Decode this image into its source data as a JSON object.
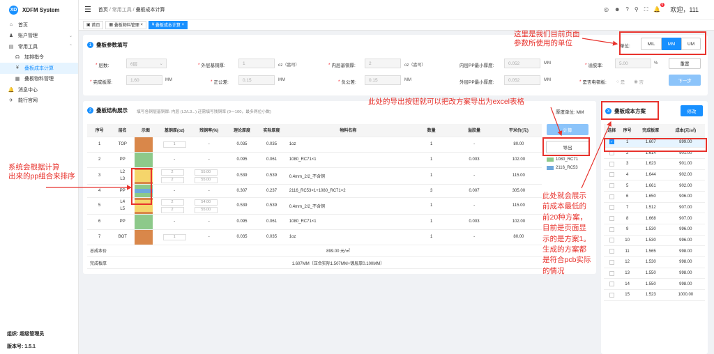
{
  "app": {
    "name": "XDFM System",
    "logo": "XD"
  },
  "sidebar": {
    "items": [
      {
        "label": "首页",
        "icon": "home-icon",
        "glyph": "⌂"
      },
      {
        "label": "账户管理",
        "icon": "user-icon",
        "glyph": "♟",
        "arrow": "⌄"
      },
      {
        "label": "常用工具",
        "icon": "tool-icon",
        "glyph": "▤",
        "arrow": "⌃"
      },
      {
        "label": "加排指令",
        "icon": "cmd-icon",
        "glyph": "☊"
      },
      {
        "label": "叠板成本计算",
        "icon": "yen-icon",
        "glyph": "¥"
      },
      {
        "label": "叠板物料管理",
        "icon": "grid-icon",
        "glyph": "▦"
      },
      {
        "label": "消息中心",
        "icon": "bell-icon",
        "glyph": "🔔"
      },
      {
        "label": "能行官网",
        "icon": "send-icon",
        "glyph": "✈"
      }
    ],
    "org": "组织: 超级管理员",
    "version": "版本号: 1.5.1"
  },
  "header": {
    "breadcrumb": [
      "首页",
      "常用工具",
      "叠板成本计算"
    ],
    "welcome": "欢迎，111",
    "notify_count": "6"
  },
  "tabs": [
    "首页",
    "叠板物料管理",
    "叠板成本计算"
  ],
  "section1": {
    "title": "叠板参数填写",
    "unit_label": "单位:",
    "units": [
      "MIL",
      "MM",
      "UM"
    ],
    "selected_unit": "MM",
    "fields": {
      "layers": {
        "label": "层数:",
        "value": "6层"
      },
      "outer_cu": {
        "label": "外层基铜厚:",
        "value": "1",
        "unit": "oz（盎司）"
      },
      "inner_cu": {
        "label": "内层基铜厚:",
        "value": "2",
        "unit": "oz（盎司）"
      },
      "pp_min": {
        "label": "内层PP最小厚度:",
        "value": "0.052",
        "unit": "MM"
      },
      "overflow": {
        "label": "溢胶率:",
        "value": "5.00",
        "unit": "%"
      },
      "finish": {
        "label": "完成板厚:",
        "value": "1.60",
        "unit": "MM"
      },
      "pos_tol": {
        "label": "正公差:",
        "value": "0.15",
        "unit": "MM"
      },
      "neg_tol": {
        "label": "负公差:",
        "value": "0.15",
        "unit": "MM"
      },
      "pp_max": {
        "label": "外层PP最小厚度:",
        "value": "0.052",
        "unit": "MM"
      },
      "cu_plate": {
        "label": "是否电铜板:",
        "opt1": "是",
        "opt2": "否"
      }
    },
    "reset": "重置",
    "next": "下一步"
  },
  "section2": {
    "title": "叠板结构展示",
    "hint": "填写各铜层基铜厚: 内层 (L2/L3...) 还需填写残铜率 (0～100，最多两位小数)",
    "thick_unit": "厚度单位: MM",
    "calc": "计算",
    "export": "导出",
    "columns": [
      "序号",
      "层名",
      "示图",
      "基铜厚(oz)",
      "残铜率(%)",
      "理论厚度",
      "实际厚度",
      "物料名称",
      "数量",
      "溢胶量",
      "平米价(元)"
    ],
    "rows": [
      {
        "no": "1",
        "name": "TOP",
        "cu": "1",
        "res": "-",
        "theo": "0.035",
        "act": "0.035",
        "mat": "1oz",
        "qty": "1",
        "ov": "-",
        "price": "80.00"
      },
      {
        "no": "2",
        "name": "PP",
        "cu": "-",
        "res": "-",
        "theo": "0.095",
        "act": "0.061",
        "mat": "1080_RC71×1",
        "qty": "1",
        "ov": "0.003",
        "price": "102.00"
      },
      {
        "no": "3",
        "name": "L2\nL3",
        "cu2": [
          "2",
          "2"
        ],
        "res2": [
          "55.00",
          "55.00"
        ],
        "theo": "0.539",
        "act": "0.539",
        "mat": "0.4mm_2/2_不含铜",
        "qty": "1",
        "ov": "-",
        "price": "115.00"
      },
      {
        "no": "4",
        "name": "PP",
        "cu": "-",
        "res": "-",
        "theo": "0.307",
        "act": "0.237",
        "mat": "2116_RC53×1+1080_RC71×2",
        "qty": "3",
        "ov": "0.007",
        "price": "305.00"
      },
      {
        "no": "5",
        "name": "L4\nL5",
        "cu2": [
          "2",
          "2"
        ],
        "res2": [
          "54.00",
          "55.00"
        ],
        "theo": "0.539",
        "act": "0.539",
        "mat": "0.4mm_2/2_不含铜",
        "qty": "1",
        "ov": "-",
        "price": "115.00"
      },
      {
        "no": "6",
        "name": "PP",
        "cu": "-",
        "res": "-",
        "theo": "0.095",
        "act": "0.061",
        "mat": "1080_RC71×1",
        "qty": "1",
        "ov": "0.003",
        "price": "102.00"
      },
      {
        "no": "7",
        "name": "BOT",
        "cu": "1",
        "res": "-",
        "theo": "0.035",
        "act": "0.035",
        "mat": "1oz",
        "qty": "1",
        "ov": "-",
        "price": "80.00"
      }
    ],
    "total_cost_label": "总成本价",
    "total_cost": "899.00 元/㎡",
    "finish_label": "完成板厚",
    "finish_value": "1.607MM（压合实际1.507MM+镀层厚0.100MM）",
    "legend": [
      "1080_RC71",
      "2116_RC53"
    ]
  },
  "section3": {
    "title": "叠板成本方案",
    "edit": "修改",
    "columns": [
      "选择",
      "序号",
      "完成板厚",
      "成本(元/㎡)"
    ],
    "rows": [
      [
        "1",
        "1.607",
        "899.00"
      ],
      [
        "2",
        "1.614",
        "901.00"
      ],
      [
        "3",
        "1.623",
        "901.00"
      ],
      [
        "4",
        "1.644",
        "902.00"
      ],
      [
        "5",
        "1.661",
        "902.00"
      ],
      [
        "6",
        "1.650",
        "906.00"
      ],
      [
        "7",
        "1.512",
        "907.00"
      ],
      [
        "8",
        "1.668",
        "907.00"
      ],
      [
        "9",
        "1.530",
        "996.00"
      ],
      [
        "10",
        "1.530",
        "996.00"
      ],
      [
        "11",
        "1.565",
        "998.00"
      ],
      [
        "12",
        "1.530",
        "998.00"
      ],
      [
        "13",
        "1.550",
        "998.00"
      ],
      [
        "14",
        "1.550",
        "998.00"
      ],
      [
        "15",
        "1.523",
        "1000.00"
      ]
    ]
  },
  "annotations": {
    "unit": "这里是我们目前页面\n参数所使用的单位",
    "export": "此处的导出按钮就可以把改方案导出为excel表格",
    "sort": "系统会根据计算\n出来的pp组合来排序",
    "plan": "此处就会展示\n前成本最低的\n前20种方案，\n目前是页面显\n示的是方案1。\n生成的方案都\n是符合pcb实际\n的情况"
  },
  "colors": {
    "accent": "#1890ff",
    "annot": "#e8332d",
    "copper": "#d9874a",
    "pp": "#8dc98a",
    "core": "#f5d56b",
    "pp2": "#6fa8dc"
  }
}
